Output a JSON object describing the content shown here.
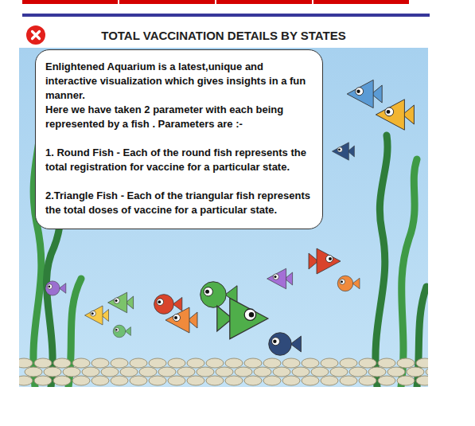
{
  "tabs": [
    {
      "selected": false
    },
    {
      "selected": false
    },
    {
      "selected": false
    },
    {
      "selected": false
    }
  ],
  "dialog": {
    "title": "TOTAL VACCINATION DETAILS BY STATES"
  },
  "info": {
    "intro": "Enlightened Aquarium is a latest,unique and interactive visualization which gives insights in a fun manner.",
    "note": "Here we have taken 2 parameter with each being represented by a fish . Parameters are :-",
    "parameters": [
      "1. Round Fish - Each of the round fish represents the total registration for vaccine for a particular state.",
      "2.Triangle Fish - Each of the triangular fish represents the total doses of vaccine for a particular state."
    ]
  },
  "fish": [
    {
      "kind": "triangle",
      "color": "#5b9bd5"
    },
    {
      "kind": "triangle",
      "color": "#f2b531"
    },
    {
      "kind": "triangle",
      "color": "#2f4f7f"
    },
    {
      "kind": "triangle",
      "color": "#d9442b"
    },
    {
      "kind": "round",
      "color": "#f08a3c"
    },
    {
      "kind": "round",
      "color": "#9b6fd0"
    },
    {
      "kind": "triangle",
      "color": "#f7c948"
    },
    {
      "kind": "triangle",
      "color": "#7cc36b"
    },
    {
      "kind": "round",
      "color": "#6fbf73"
    },
    {
      "kind": "round",
      "color": "#d9442b"
    },
    {
      "kind": "triangle",
      "color": "#f08a3c"
    },
    {
      "kind": "triangle",
      "color": "#a46fd6"
    },
    {
      "kind": "round",
      "color": "#4fae4a"
    },
    {
      "kind": "triangle",
      "color": "#4fae4a"
    },
    {
      "kind": "round",
      "color": "#2f4a7a"
    }
  ]
}
